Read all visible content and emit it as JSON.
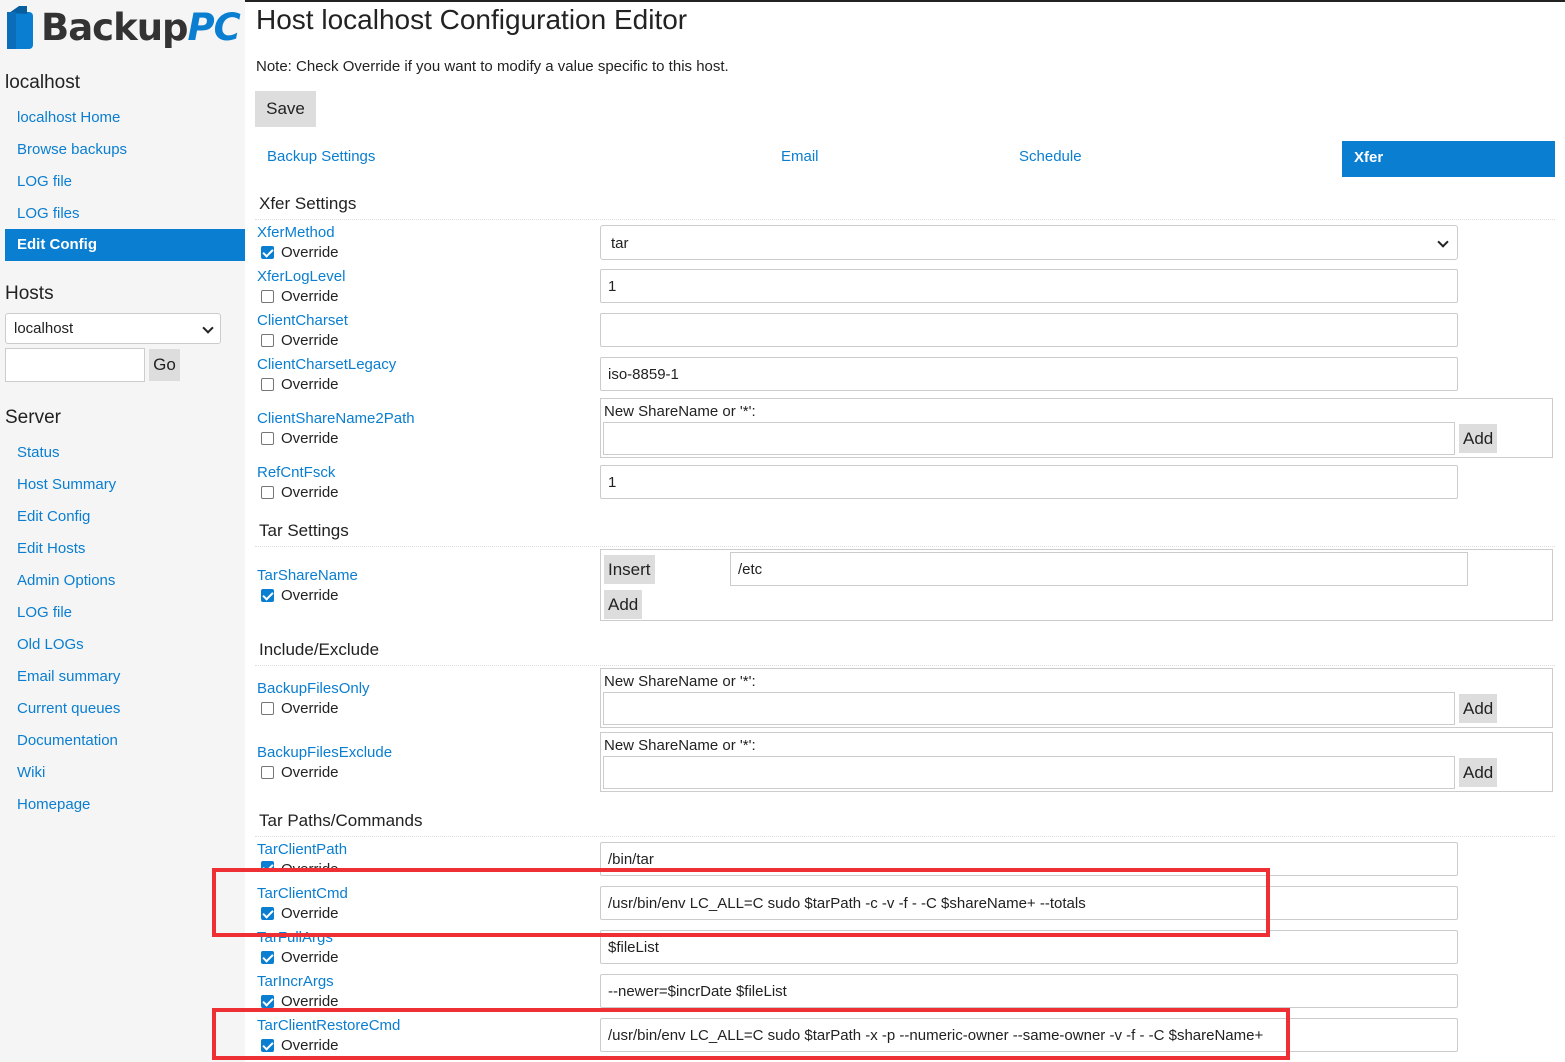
{
  "sidebar": {
    "logo_a": "Backup",
    "logo_b": "PC",
    "host_heading": "localhost",
    "host_links": [
      "localhost Home",
      "Browse backups",
      "LOG file",
      "LOG files",
      "Edit Config"
    ],
    "hosts_heading": "Hosts",
    "host_select": "localhost",
    "go_label": "Go",
    "server_heading": "Server",
    "server_links": [
      "Status",
      "Host Summary",
      "Edit Config",
      "Edit Hosts",
      "Admin Options",
      "LOG file",
      "Old LOGs",
      "Email summary",
      "Current queues",
      "Documentation",
      "Wiki",
      "Homepage"
    ]
  },
  "main": {
    "title": "Host localhost Configuration Editor",
    "note": "Note: Check Override if you want to modify a value specific to this host.",
    "save_label": "Save",
    "tabs": [
      "Backup Settings",
      "Email",
      "Schedule",
      "Xfer"
    ],
    "override_label": "Override",
    "new_share_label": "New ShareName or '*':",
    "add_label": "Add",
    "insert_label": "Insert",
    "sections": {
      "xfer": "Xfer Settings",
      "tar": "Tar Settings",
      "include": "Include/Exclude",
      "tar_paths": "Tar Paths/Commands"
    },
    "params": {
      "XferMethod": {
        "label": "XferMethod",
        "value": "tar",
        "override": true
      },
      "XferLogLevel": {
        "label": "XferLogLevel",
        "value": "1",
        "override": false
      },
      "ClientCharset": {
        "label": "ClientCharset",
        "value": "",
        "override": false
      },
      "ClientCharsetLegacy": {
        "label": "ClientCharsetLegacy",
        "value": "iso-8859-1",
        "override": false
      },
      "ClientShareName2Path": {
        "label": "ClientShareName2Path",
        "override": false
      },
      "RefCntFsck": {
        "label": "RefCntFsck",
        "value": "1",
        "override": false
      },
      "TarShareName": {
        "label": "TarShareName",
        "value": "/etc",
        "override": true
      },
      "BackupFilesOnly": {
        "label": "BackupFilesOnly",
        "override": false
      },
      "BackupFilesExclude": {
        "label": "BackupFilesExclude",
        "override": false
      },
      "TarClientPath": {
        "label": "TarClientPath",
        "value": "/bin/tar",
        "override": true
      },
      "TarClientCmd": {
        "label": "TarClientCmd",
        "value": "/usr/bin/env LC_ALL=C sudo $tarPath -c -v -f - -C $shareName+ --totals",
        "override": true
      },
      "TarFullArgs": {
        "label": "TarFullArgs",
        "value": "$fileList",
        "override": true
      },
      "TarIncrArgs": {
        "label": "TarIncrArgs",
        "value": "--newer=$incrDate $fileList",
        "override": true
      },
      "TarClientRestoreCmd": {
        "label": "TarClientRestoreCmd",
        "value": "/usr/bin/env LC_ALL=C sudo $tarPath -x -p --numeric-owner --same-owner -v -f - -C $shareName+",
        "override": true
      }
    }
  },
  "colors": {
    "link": "#0a7ed0",
    "highlight": "#ee2f33",
    "sidebar_bg": "#f5f5f5"
  }
}
